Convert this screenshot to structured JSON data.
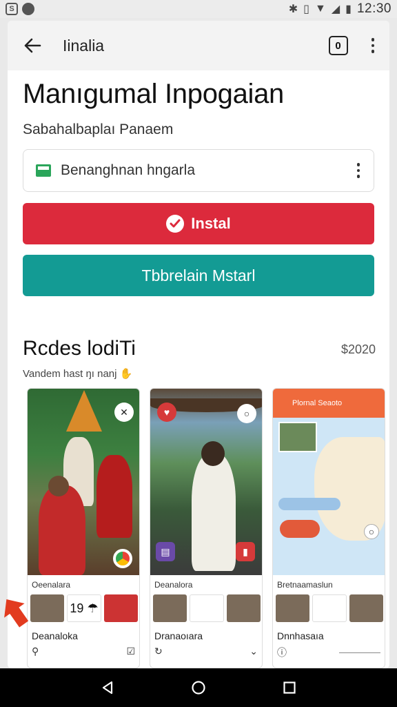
{
  "status_bar": {
    "time": "12:30"
  },
  "toolbar": {
    "title": "Iinalia"
  },
  "page": {
    "headline": "Manıgumal Inpogaian",
    "subhead": "Sabahalbaplaı Panaem"
  },
  "source": {
    "label": "Benanghnan hngarla"
  },
  "buttons": {
    "install": "Instal",
    "secondary": "Tbbrelain Mstarl"
  },
  "section": {
    "title": "Rcdes lodiTi",
    "price": "$2020",
    "subtitle": "Vandem hast ŋı nanj"
  },
  "screenshots": [
    {
      "caption": "Oeenalara",
      "thumb_text": "19  ☂",
      "app_name": "Deanaloka"
    },
    {
      "caption": "Deanalora",
      "thumb_text": "",
      "app_name": "Dranaoıara"
    },
    {
      "caption": "Bretnaamaslun",
      "map_title": "Plornal Seaoto",
      "app_name": "Dnnhasaıa"
    }
  ],
  "colors": {
    "install": "#dc2a3c",
    "secondary": "#139b94",
    "map_header": "#ef6a3c"
  }
}
